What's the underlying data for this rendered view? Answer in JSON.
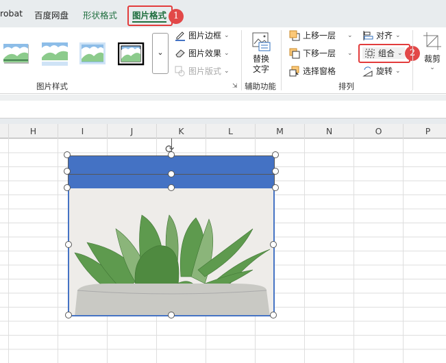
{
  "tabs": [
    {
      "label": "robat"
    },
    {
      "label": "百度网盘"
    },
    {
      "label": "形状格式"
    },
    {
      "label": "图片格式",
      "active": true
    }
  ],
  "annotations": {
    "step1": "1",
    "step2": "2"
  },
  "ribbon": {
    "picture_styles": {
      "group_label": "图片样式",
      "border": "图片边框",
      "effects": "图片效果",
      "layout": "图片版式",
      "more": "⌄"
    },
    "accessibility": {
      "alt_text_line1": "替换",
      "alt_text_line2": "文字",
      "group_label": "辅助功能"
    },
    "arrange": {
      "bring_forward": "上移一层",
      "send_backward": "下移一层",
      "selection_pane": "选择窗格",
      "align": "对齐",
      "group": "组合",
      "rotate": "旋转",
      "group_label": "排列"
    },
    "crop": {
      "label": "裁剪"
    }
  },
  "columns": [
    "H",
    "I",
    "J",
    "K",
    "L",
    "M",
    "N",
    "O",
    "P"
  ],
  "colors": {
    "accent": "#1e6e3e",
    "shape_fill": "#4472c4",
    "highlight": "#e23b3b"
  }
}
